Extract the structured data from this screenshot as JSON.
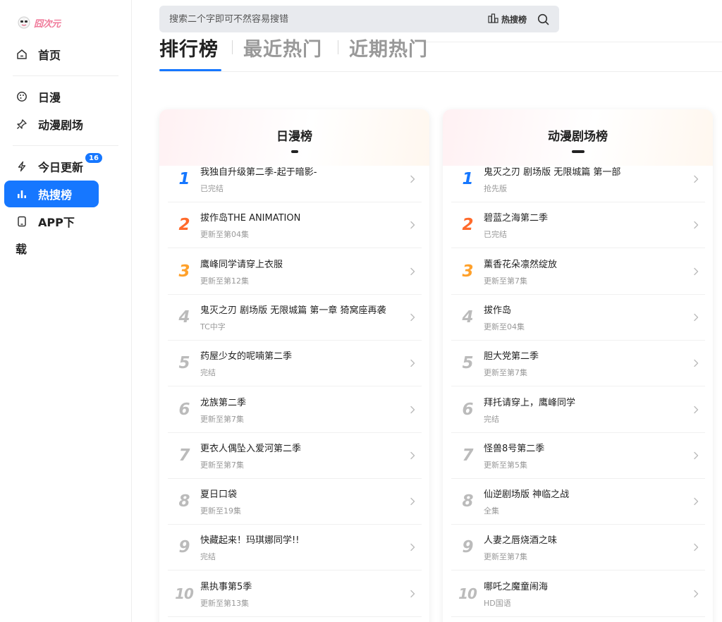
{
  "logo": {
    "text": "囧次元"
  },
  "sidebar": {
    "items": [
      {
        "label": "首页"
      },
      {
        "label": "日漫"
      },
      {
        "label": "动漫剧场"
      },
      {
        "label": "今日更新",
        "badge": "16"
      },
      {
        "label": "热搜榜"
      }
    ],
    "app": {
      "label_line1": "APP下",
      "label_line2": "载"
    }
  },
  "search": {
    "placeholder": "搜索二个字即可不然容易搜错",
    "hot_label": "热搜榜"
  },
  "tabs": [
    {
      "label": "排行榜"
    },
    {
      "label": "最近热门"
    },
    {
      "label": "近期热门"
    }
  ],
  "boards": [
    {
      "title": "日漫榜",
      "rows": [
        {
          "rank": "1",
          "title": "我独自升级第二季-起于暗影-",
          "sub": "已完结"
        },
        {
          "rank": "2",
          "title": "拔作岛THE ANIMATION",
          "sub": "更新至第04集"
        },
        {
          "rank": "3",
          "title": "鹰峰同学请穿上衣服",
          "sub": "更新至第12集"
        },
        {
          "rank": "4",
          "title": "鬼灭之刃 剧场版 无限城篇 第一章 猗窝座再袭",
          "sub": "TC中字"
        },
        {
          "rank": "5",
          "title": "药屋少女的呢喃第二季",
          "sub": "完结"
        },
        {
          "rank": "6",
          "title": "龙族第二季",
          "sub": "更新至第7集"
        },
        {
          "rank": "7",
          "title": "更衣人偶坠入爱河第二季",
          "sub": "更新至第7集"
        },
        {
          "rank": "8",
          "title": "夏日口袋",
          "sub": "更新至19集"
        },
        {
          "rank": "9",
          "title": "快藏起来！玛琪娜同学!!",
          "sub": "完结"
        },
        {
          "rank": "10",
          "title": "黑执事第5季",
          "sub": "更新至第13集"
        }
      ]
    },
    {
      "title": "动漫剧场榜",
      "rows": [
        {
          "rank": "1",
          "title": "鬼灭之刃 剧场版 无限城篇 第一部",
          "sub": "抢先版"
        },
        {
          "rank": "2",
          "title": "碧蓝之海第二季",
          "sub": "已完结"
        },
        {
          "rank": "3",
          "title": "薰香花朵凛然绽放",
          "sub": "更新至第7集"
        },
        {
          "rank": "4",
          "title": "拔作岛",
          "sub": "更新至04集"
        },
        {
          "rank": "5",
          "title": "胆大党第二季",
          "sub": "更新至第7集"
        },
        {
          "rank": "6",
          "title": "拜托请穿上，鹰峰同学",
          "sub": "完结"
        },
        {
          "rank": "7",
          "title": "怪兽8号第二季",
          "sub": "更新至第5集"
        },
        {
          "rank": "8",
          "title": "仙逆剧场版 神临之战",
          "sub": "全集"
        },
        {
          "rank": "9",
          "title": "人妻之唇烧酒之味",
          "sub": "更新至第7集"
        },
        {
          "rank": "10",
          "title": "哪吒之魔童闹海",
          "sub": "HD国语"
        }
      ]
    }
  ],
  "colors": {
    "accent": "#1677ff",
    "rank1": "#1677ff",
    "rank2": "#ff6a2b",
    "rank3": "#ffa12b",
    "rank_other": "#bbbbbb"
  }
}
